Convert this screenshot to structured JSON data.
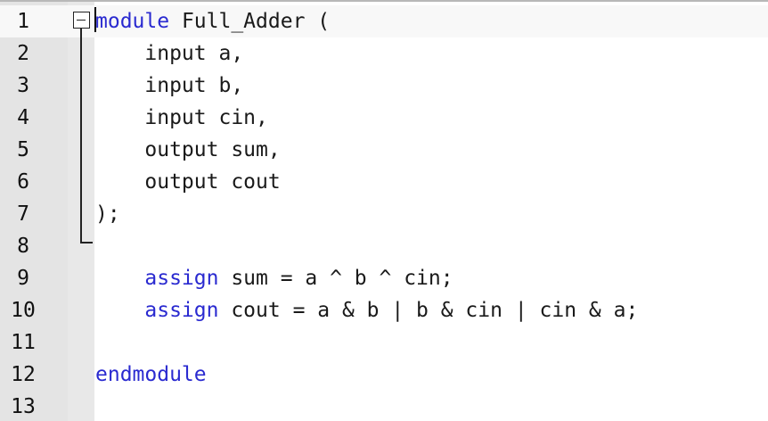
{
  "editor": {
    "language": "verilog",
    "lines": [
      {
        "num": "1",
        "indent": "",
        "kw": "module",
        "rest": " Full_Adder ("
      },
      {
        "num": "2",
        "indent": "    ",
        "kw": "",
        "rest": "input a,"
      },
      {
        "num": "3",
        "indent": "    ",
        "kw": "",
        "rest": "input b,"
      },
      {
        "num": "4",
        "indent": "    ",
        "kw": "",
        "rest": "input cin,"
      },
      {
        "num": "5",
        "indent": "    ",
        "kw": "",
        "rest": "output sum,"
      },
      {
        "num": "6",
        "indent": "    ",
        "kw": "",
        "rest": "output cout"
      },
      {
        "num": "7",
        "indent": "",
        "kw": "",
        "rest": ");"
      },
      {
        "num": "8",
        "indent": "",
        "kw": "",
        "rest": ""
      },
      {
        "num": "9",
        "indent": "    ",
        "kw": "assign",
        "rest": " sum = a ^ b ^ cin;"
      },
      {
        "num": "10",
        "indent": "    ",
        "kw": "assign",
        "rest": " cout = a & b | b & cin | cin & a;"
      },
      {
        "num": "11",
        "indent": "",
        "kw": "",
        "rest": ""
      },
      {
        "num": "12",
        "indent": "",
        "kw": "endmodule",
        "rest": ""
      },
      {
        "num": "13",
        "indent": "",
        "kw": "",
        "rest": ""
      }
    ],
    "fold": {
      "start_line": "1",
      "end_line": "8",
      "state": "expanded"
    },
    "caret_line": "1",
    "colors": {
      "keyword": "#2a2ad0",
      "text": "#1a1a1a",
      "gutter": "#e4e4e4",
      "fold_margin": "#f0f0f0",
      "background": "#ffffff"
    }
  }
}
